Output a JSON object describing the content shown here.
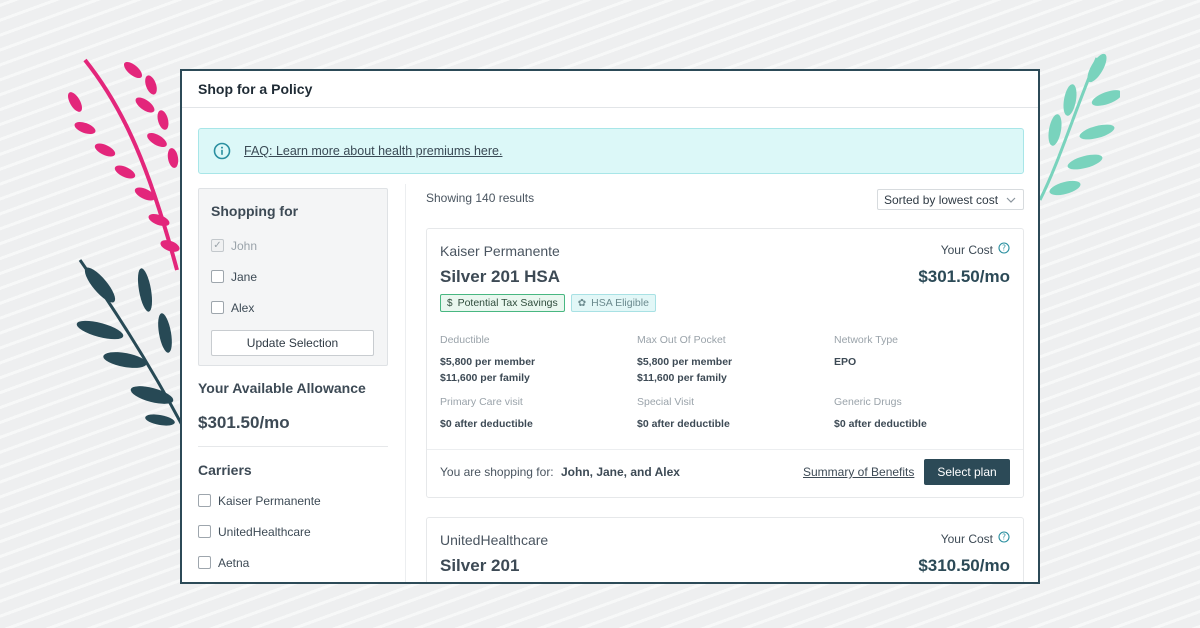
{
  "window": {
    "title": "Shop for a Policy"
  },
  "faq": {
    "text": "FAQ: Learn more about health premiums here.",
    "icon": "info-icon"
  },
  "shopping": {
    "title": "Shopping for",
    "members": [
      {
        "name": "John",
        "checked": true,
        "disabled": true
      },
      {
        "name": "Jane",
        "checked": false
      },
      {
        "name": "Alex",
        "checked": false
      }
    ],
    "update_label": "Update Selection"
  },
  "allowance": {
    "title": "Your Available Allowance",
    "value": "$301.50/mo"
  },
  "carriers": {
    "title": "Carriers",
    "items": [
      {
        "name": "Kaiser Permanente",
        "checked": false
      },
      {
        "name": "UnitedHealthcare",
        "checked": false
      },
      {
        "name": "Aetna",
        "checked": false
      }
    ]
  },
  "results": {
    "count_text": "Showing 140 results",
    "sort_label": "Sorted by lowest cost",
    "plans": [
      {
        "carrier": "Kaiser Permanente",
        "plan": "Silver 201 HSA",
        "cost_label": "Your Cost",
        "price": "$301.50/mo",
        "tags": [
          {
            "label": "Potential Tax Savings",
            "icon": "dollar-icon"
          },
          {
            "label": "HSA Eligible",
            "icon": "hsa-icon"
          }
        ],
        "details": [
          {
            "label": "Deductible",
            "value_1": "$5,800 per member",
            "value_2": "$11,600 per family"
          },
          {
            "label": "Max Out Of Pocket",
            "value_1": "$5,800 per member",
            "value_2": "$11,600 per family"
          },
          {
            "label": "Network Type",
            "value_1": "EPO",
            "value_2": ""
          },
          {
            "label": "Primary Care visit",
            "value_1": "$0 after deductible",
            "value_2": ""
          },
          {
            "label": "Special Visit",
            "value_1": "$0 after deductible",
            "value_2": ""
          },
          {
            "label": "Generic Drugs",
            "value_1": "$0 after deductible",
            "value_2": ""
          }
        ],
        "shopping_for_label": "You are shopping for:",
        "shopping_for_names": "John, Jane, and Alex",
        "summary_link": "Summary of Benefits",
        "select_label": "Select plan"
      },
      {
        "carrier": "UnitedHealthcare",
        "plan": "Silver 201",
        "cost_label": "Your Cost",
        "price": "$310.50/mo"
      }
    ]
  },
  "colors": {
    "accent": "#2c4a57",
    "faq_bg": "#dcf8f8",
    "leaf_pink": "#e3267b",
    "leaf_teal": "#79d3bd",
    "leaf_dark": "#274955"
  }
}
